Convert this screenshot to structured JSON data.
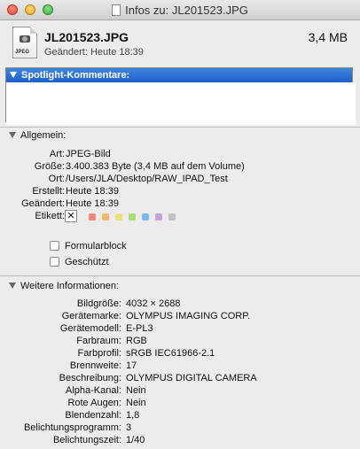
{
  "window": {
    "title": "Infos zu: JL201523.JPG"
  },
  "header": {
    "filename": "JL201523.JPG",
    "size": "3,4 MB",
    "modified": "Geändert:  Heute 18:39",
    "icon_label": "JPEG"
  },
  "spotlight": {
    "label": "Spotlight-Kommentare:",
    "value": ""
  },
  "general": {
    "label": "Allgemein:",
    "rows": [
      {
        "key": "Art:",
        "value": "JPEG-Bild"
      },
      {
        "key": "Größe:",
        "value": "3.400.383 Byte (3,4 MB auf dem Volume)"
      },
      {
        "key": "Ort:",
        "value": "/Users/JLA/Desktop/RAW_IPAD_Test"
      },
      {
        "key": "Erstellt:",
        "value": "Heute 18:39"
      },
      {
        "key": "Geändert:",
        "value": "Heute 18:39"
      },
      {
        "key": "Etikett:",
        "value": ""
      }
    ],
    "label_none_glyph": "✕",
    "label_colors": [
      "#f2897f",
      "#f4b86a",
      "#ece27a",
      "#a9dd72",
      "#82b8f0",
      "#c6a1e0",
      "#c2c2c2"
    ],
    "checkboxes": [
      {
        "label": "Formularblock",
        "checked": false
      },
      {
        "label": "Geschützt",
        "checked": false
      }
    ]
  },
  "more": {
    "label": "Weitere Informationen:",
    "rows": [
      {
        "key": "Bildgröße:",
        "value": "4032 × 2688"
      },
      {
        "key": "Gerätemarke:",
        "value": "OLYMPUS IMAGING CORP."
      },
      {
        "key": "Gerätemodell:",
        "value": "E-PL3"
      },
      {
        "key": "Farbraum:",
        "value": "RGB"
      },
      {
        "key": "Farbprofil:",
        "value": "sRGB IEC61966-2.1"
      },
      {
        "key": "Brennweite:",
        "value": "17"
      },
      {
        "key": "Beschreibung:",
        "value": "OLYMPUS DIGITAL CAMERA"
      },
      {
        "key": "Alpha-Kanal:",
        "value": "Nein"
      },
      {
        "key": "Rote Augen:",
        "value": "Nein"
      },
      {
        "key": "Blendenzahl:",
        "value": "1,8"
      },
      {
        "key": "Belichtungsprogramm:",
        "value": "3"
      },
      {
        "key": "Belichtungszeit:",
        "value": "1/40"
      }
    ]
  }
}
